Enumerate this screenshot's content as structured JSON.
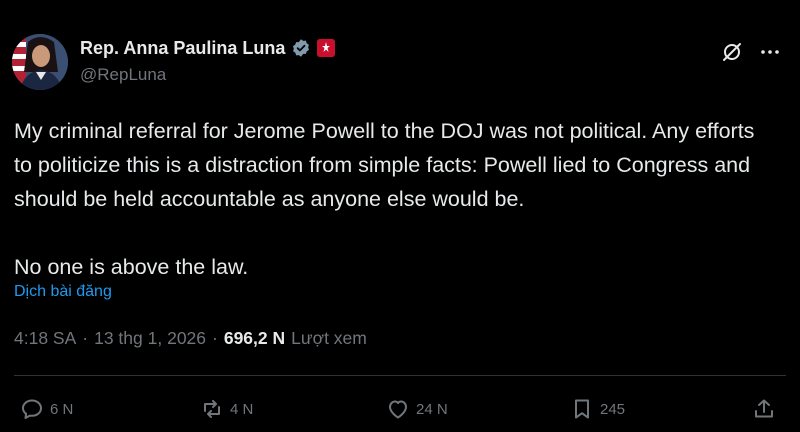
{
  "author": {
    "name": "Rep. Anna Paulina Luna",
    "handle": "@RepLuna",
    "avatar_icon": "profile-photo",
    "verified_icon": "verified-badge-icon",
    "gov_icon": "government-affiliation-icon"
  },
  "tweet": {
    "text": "My criminal referral for Jerome Powell to the DOJ was not political. Any efforts to politicize this is a distraction from simple facts: Powell lied to Congress and should be held accountable as anyone else would be.\n\nNo one is above the law.",
    "translate_label": "Dịch bài đăng"
  },
  "meta": {
    "time": "4:18 SA",
    "separator1": "·",
    "date": "13 thg 1, 2026",
    "separator2": "·",
    "views_count": "696,2 N",
    "views_label": "Lượt xem"
  },
  "actions": {
    "reply_count": "6 N",
    "repost_count": "4 N",
    "like_count": "24 N",
    "bookmark_count": "245"
  },
  "colors": {
    "background": "#000000",
    "text": "#e7e9ea",
    "muted": "#71767b",
    "link": "#1d9bf0",
    "verified": "#829aab"
  }
}
